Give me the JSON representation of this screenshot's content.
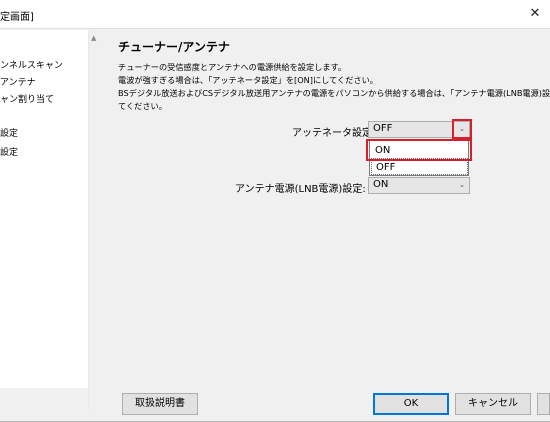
{
  "window": {
    "title": "定画面]"
  },
  "sidebar": {
    "items": [
      {
        "label": "ンネルスキャン"
      },
      {
        "label": "アンテナ"
      },
      {
        "label": "ャン割り当て"
      },
      {
        "label": "設定"
      },
      {
        "label": "設定"
      }
    ]
  },
  "main": {
    "title": "チューナー/アンテナ",
    "description": [
      "チューナーの受信感度とアンテナへの電源供給を設定します。",
      "電波が強すぎる場合は、「アッテネータ設定」を[ON]にしてください。",
      "BSデジタル放送およびCSデジタル放送用アンテナの電源をパソコンから供給する場合は、「アンテナ電源(LNB電源)設",
      "てください。"
    ],
    "attenuator": {
      "label": "アッテネータ設定:",
      "value": "OFF",
      "options": [
        "ON",
        "OFF"
      ]
    },
    "lnb_power": {
      "label": "アンテナ電源(LNB電源)設定:",
      "value": "ON"
    }
  },
  "buttons": {
    "manual": "取扱説明書",
    "ok": "OK",
    "cancel": "キャンセル"
  },
  "colors": {
    "highlight": "#d61f2c",
    "focus": "#0078d7"
  }
}
